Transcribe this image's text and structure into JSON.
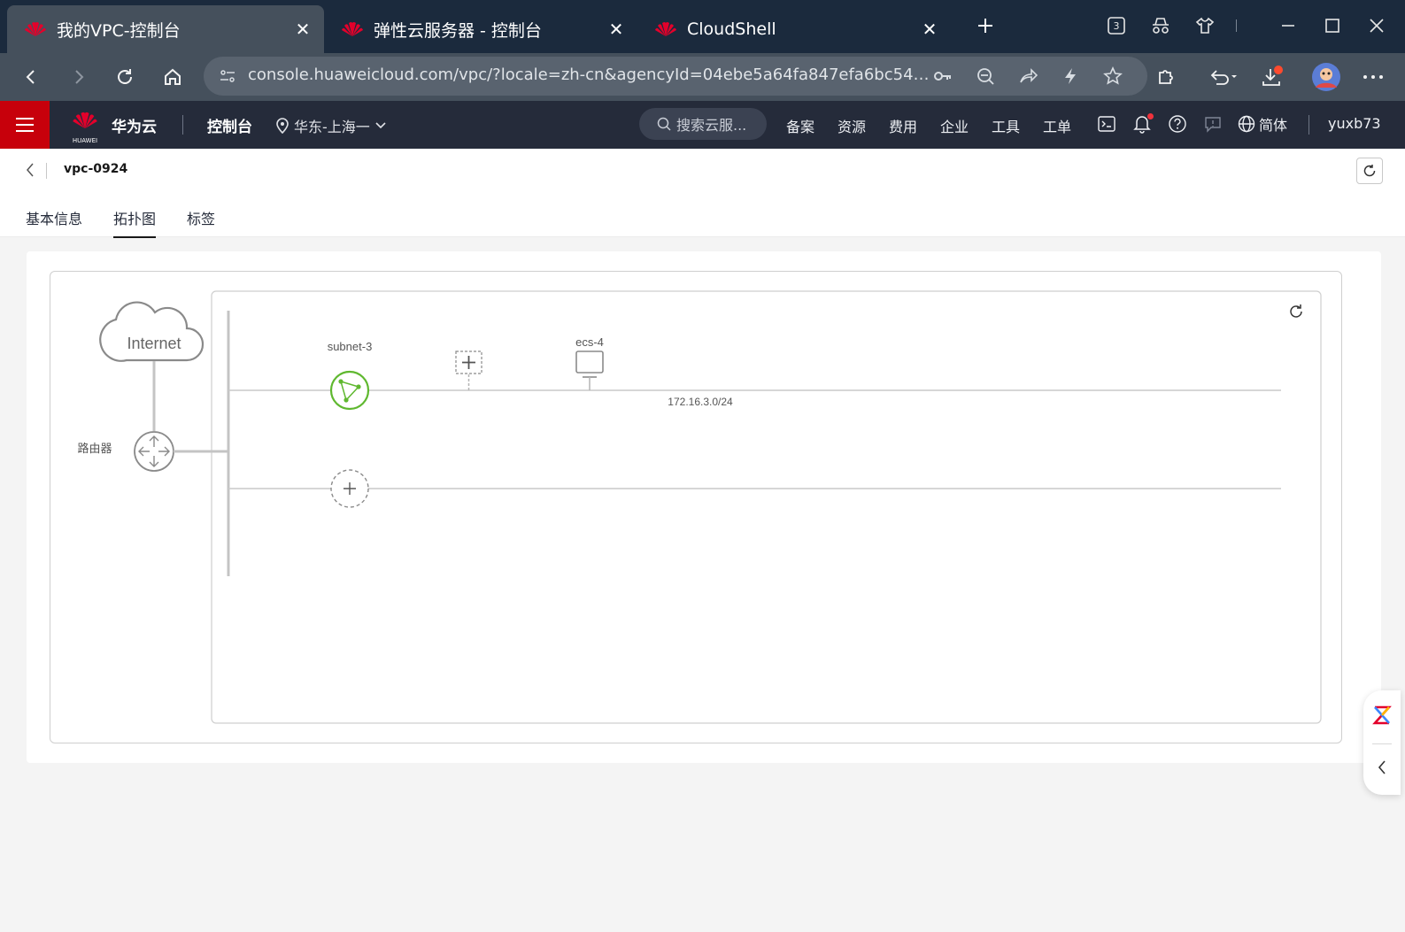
{
  "browser": {
    "tabs": [
      {
        "title": "我的VPC-控制台",
        "active": true
      },
      {
        "title": "弹性云服务器 - 控制台",
        "active": false
      },
      {
        "title": "CloudShell",
        "active": false
      }
    ],
    "tab_count": "3",
    "url": "console.huaweicloud.com/vpc/?locale=zh-cn&agencyId=04ebe5a64fa847efa6bc54f919..."
  },
  "header": {
    "brand": "华为云",
    "brand_small": "HUAWEI",
    "console": "控制台",
    "region": "华东-上海一",
    "search_placeholder": "搜索云服...",
    "nav": [
      "备案",
      "资源",
      "费用",
      "企业",
      "工具",
      "工单"
    ],
    "language": "简体",
    "user": "yuxb73"
  },
  "page": {
    "title": "vpc-0924",
    "tabs": [
      "基本信息",
      "拓扑图",
      "标签"
    ],
    "active_tab": 1
  },
  "topology": {
    "internet_label": "Internet",
    "router_label": "路由器",
    "subnet_name": "subnet-3",
    "subnet_cidr": "172.16.3.0/24",
    "ecs_name": "ecs-4"
  },
  "colors": {
    "huawei_red": "#c7000b",
    "header_dark": "#252b3a",
    "subnet_green": "#5fb82f"
  }
}
